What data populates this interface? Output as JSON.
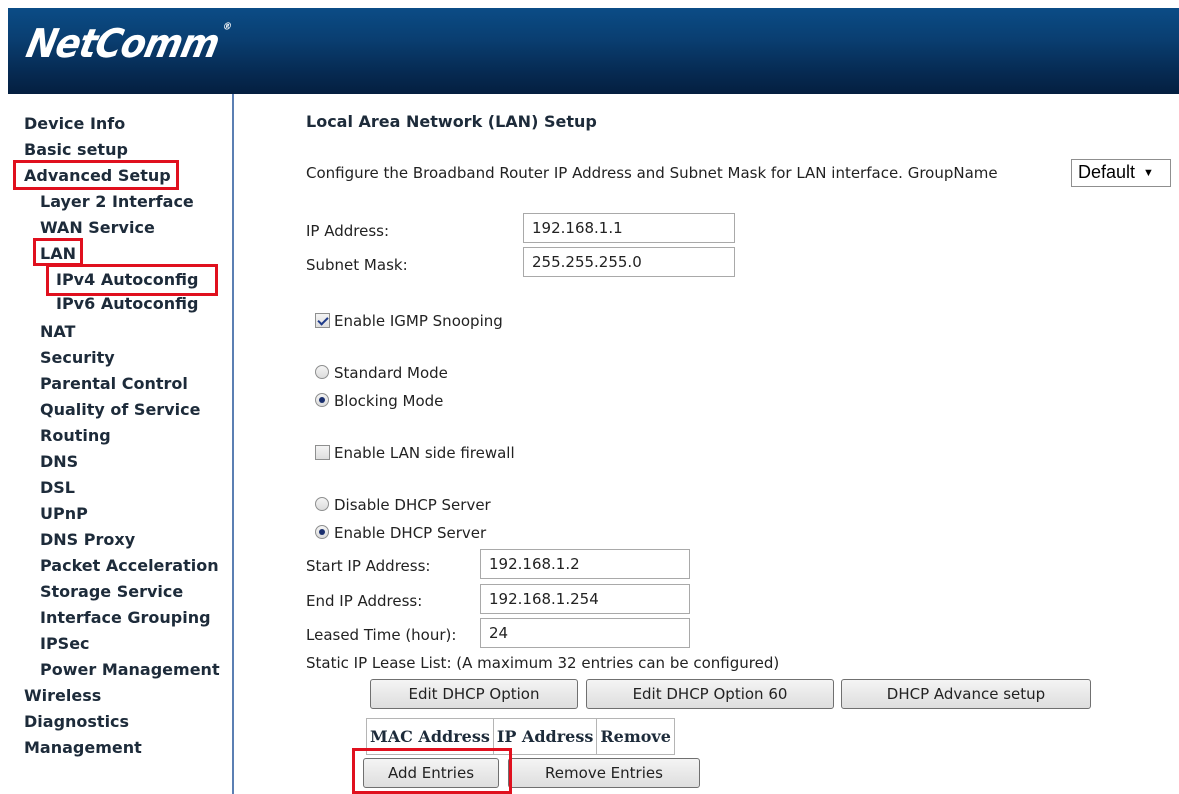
{
  "header": {
    "logo_text": "NetComm"
  },
  "sidebar": {
    "items": [
      {
        "label": "Device Info"
      },
      {
        "label": "Basic setup"
      },
      {
        "label": "Advanced Setup"
      },
      {
        "label": "Layer 2 Interface"
      },
      {
        "label": "WAN Service"
      },
      {
        "label": "LAN"
      },
      {
        "label": "IPv4 Autoconfig"
      },
      {
        "label": "IPv6 Autoconfig"
      },
      {
        "label": "NAT"
      },
      {
        "label": "Security"
      },
      {
        "label": "Parental Control"
      },
      {
        "label": "Quality of Service"
      },
      {
        "label": "Routing"
      },
      {
        "label": "DNS"
      },
      {
        "label": "DSL"
      },
      {
        "label": "UPnP"
      },
      {
        "label": "DNS Proxy"
      },
      {
        "label": "Packet Acceleration"
      },
      {
        "label": "Storage Service"
      },
      {
        "label": "Interface Grouping"
      },
      {
        "label": "IPSec"
      },
      {
        "label": "Power Management"
      },
      {
        "label": "Wireless"
      },
      {
        "label": "Diagnostics"
      },
      {
        "label": "Management"
      }
    ]
  },
  "main": {
    "title": "Local Area Network (LAN) Setup",
    "description": "Configure the Broadband Router IP Address and Subnet Mask for LAN interface. GroupName",
    "group_select": {
      "value": "Default"
    },
    "ip_address": {
      "label": "IP Address:",
      "value": "192.168.1.1"
    },
    "subnet_mask": {
      "label": "Subnet Mask:",
      "value": "255.255.255.0"
    },
    "igmp_snooping": {
      "label": "Enable IGMP Snooping",
      "checked": true
    },
    "standard_mode": {
      "label": "Standard Mode",
      "selected": false
    },
    "blocking_mode": {
      "label": "Blocking Mode",
      "selected": true
    },
    "lan_firewall": {
      "label": "Enable LAN side firewall",
      "checked": false
    },
    "disable_dhcp": {
      "label": "Disable DHCP Server",
      "selected": false
    },
    "enable_dhcp": {
      "label": "Enable DHCP Server",
      "selected": true
    },
    "start_ip": {
      "label": "Start IP Address:",
      "value": "192.168.1.2"
    },
    "end_ip": {
      "label": "End IP Address:",
      "value": "192.168.1.254"
    },
    "leased_time": {
      "label": "Leased Time (hour):",
      "value": "24"
    },
    "static_lease_note": "Static IP Lease List: (A maximum 32 entries can be configured)",
    "buttons": {
      "edit_dhcp_option": "Edit DHCP Option",
      "edit_dhcp_option_60": "Edit DHCP Option 60",
      "dhcp_advance_setup": "DHCP Advance setup",
      "add_entries": "Add Entries",
      "remove_entries": "Remove Entries"
    },
    "lease_table": {
      "columns": [
        "MAC Address",
        "IP Address",
        "Remove"
      ]
    }
  },
  "colors": {
    "header_blue": "#0a3f72",
    "highlight_red": "#e0101e"
  }
}
